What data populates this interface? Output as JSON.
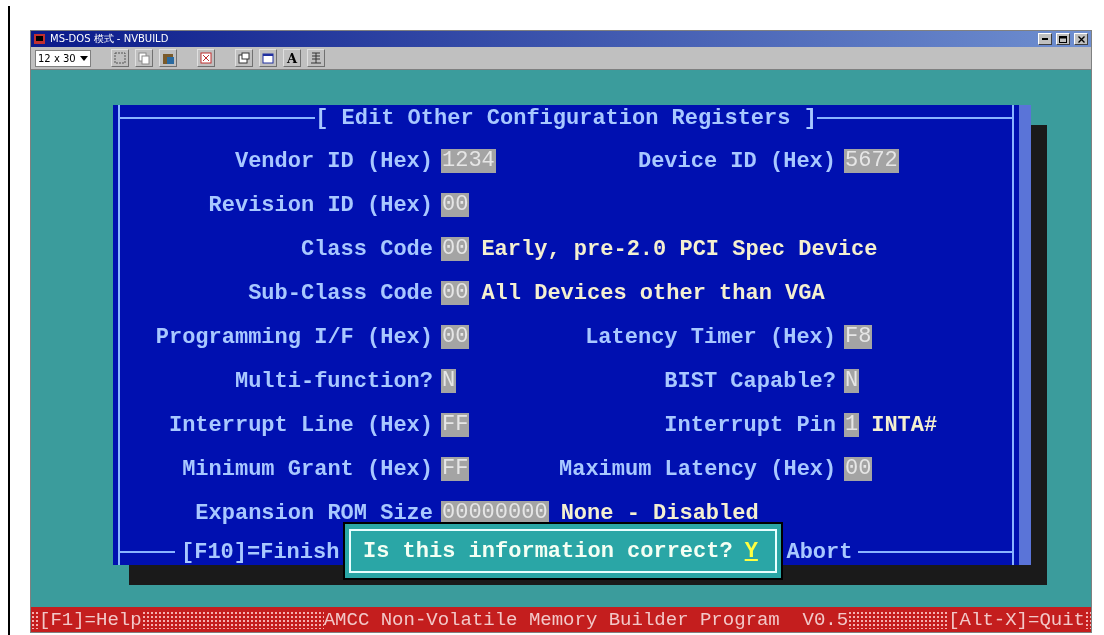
{
  "window": {
    "title": "MS-DOS 模式 - NVBUILD"
  },
  "toolbar": {
    "font_size": "12 x 30",
    "font_button": "A"
  },
  "dialog": {
    "title": "[ Edit Other Configuration Registers ]",
    "rows": [
      {
        "fields": [
          {
            "label": "Vendor ID (Hex)",
            "value": "1234"
          },
          {
            "label": "Device ID (Hex)",
            "value": "5672"
          }
        ]
      },
      {
        "fields": [
          {
            "label": "Revision ID (Hex)",
            "value": "00"
          }
        ]
      },
      {
        "fields": [
          {
            "label": "Class Code",
            "value": "00",
            "description": "Early, pre-2.0 PCI Spec Device"
          }
        ]
      },
      {
        "fields": [
          {
            "label": "Sub-Class Code",
            "value": "00",
            "description": "All Devices other than VGA"
          }
        ]
      },
      {
        "fields": [
          {
            "label": "Programming I/F (Hex)",
            "value": "00"
          },
          {
            "label": "Latency Timer (Hex)",
            "value": "F8"
          }
        ]
      },
      {
        "fields": [
          {
            "label": "Multi-function?",
            "value": "N"
          },
          {
            "label": "BIST Capable?",
            "value": "N"
          }
        ]
      },
      {
        "fields": [
          {
            "label": "Interrupt Line (Hex)",
            "value": "FF"
          },
          {
            "label": "Interrupt Pin",
            "value": "1",
            "description": "INTA#"
          }
        ]
      },
      {
        "fields": [
          {
            "label": "Minimum Grant (Hex)",
            "value": "FF"
          },
          {
            "label": "Maximum Latency (Hex)",
            "value": "00"
          }
        ]
      },
      {
        "fields": [
          {
            "label": "Expansion ROM Size",
            "value": "00000000",
            "description": "None - Disabled"
          }
        ]
      }
    ],
    "footer": {
      "finish": "[F10]=Finish",
      "abort": "Abort"
    }
  },
  "prompt": {
    "question": "Is this information correct?",
    "answer": "Y"
  },
  "status_bar": {
    "help": "[F1]=Help",
    "program": "AMCC Non-Volatile Memory Builder Program  V0.5",
    "quit": "[Alt-X]=Quit"
  }
}
